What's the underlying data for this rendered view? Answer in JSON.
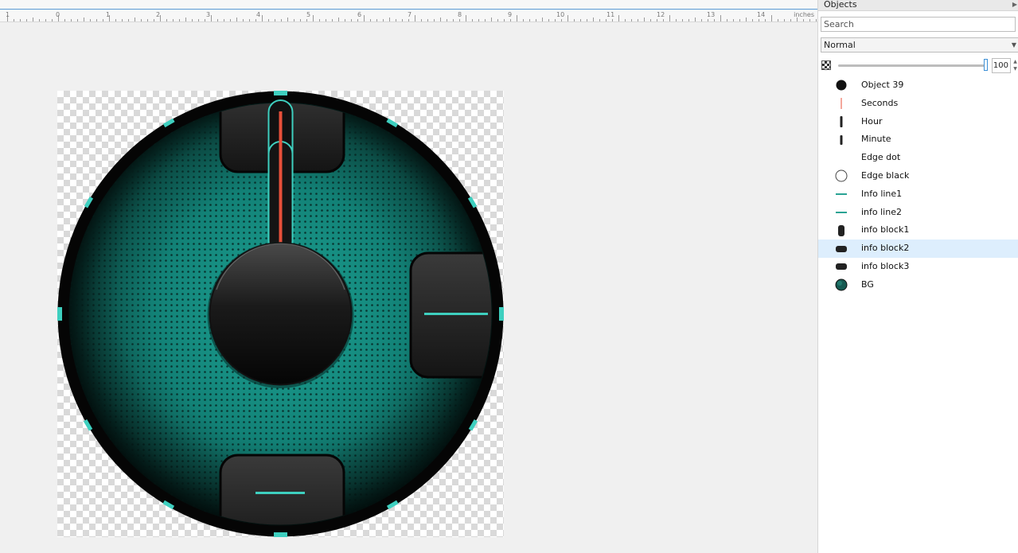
{
  "ruler": {
    "numbers": [
      "1",
      "0",
      "1",
      "2",
      "3",
      "4",
      "5",
      "6",
      "7",
      "8",
      "9",
      "10",
      "11",
      "12",
      "13",
      "14"
    ],
    "unit": "inches"
  },
  "panel": {
    "title": "Objects",
    "search_placeholder": "Search",
    "blend_mode": "Normal",
    "opacity": "100"
  },
  "objects": [
    {
      "label": "Object 39",
      "icon": "black-circle-icon"
    },
    {
      "label": "Seconds",
      "icon": "red-line-icon"
    },
    {
      "label": "Hour",
      "icon": "dark-bar-icon"
    },
    {
      "label": "Minute",
      "icon": "dark-bar-icon"
    },
    {
      "label": "Edge dot",
      "icon": "none"
    },
    {
      "label": "Edge black",
      "icon": "outline-circle-icon"
    },
    {
      "label": "Info line1",
      "icon": "teal-line-icon"
    },
    {
      "label": "info line2",
      "icon": "teal-line-icon"
    },
    {
      "label": "info block1",
      "icon": "dark-rounded-block-icon"
    },
    {
      "label": "info block2",
      "icon": "dark-flat-block-icon",
      "selected": true
    },
    {
      "label": "info block3",
      "icon": "dark-flat-block-icon"
    },
    {
      "label": "BG",
      "icon": "teal-globe-icon"
    }
  ],
  "colors": {
    "accent": "#3ecfbf",
    "teal_face": "#0f6b61",
    "seconds_hand": "#e8503a",
    "selection": "#ddeefd"
  }
}
